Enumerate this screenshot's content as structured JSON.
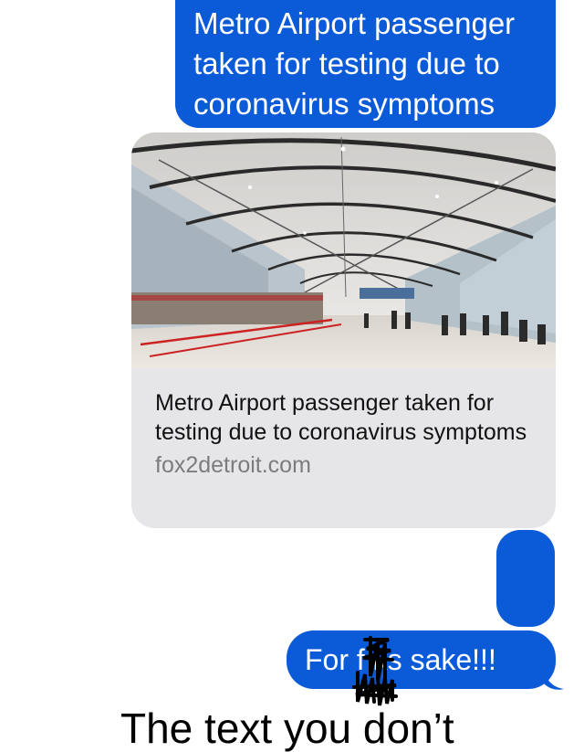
{
  "messages": {
    "first": {
      "text": "Metro Airport passenger taken for testing due to coronavirus symptoms"
    },
    "link_preview": {
      "title": "Metro Airport passenger taken for testing due to coronavirus symptoms",
      "domain": "fox2detroit.com",
      "image": "airport-terminal-photo"
    },
    "second": {
      "text": ""
    },
    "third": {
      "text": "For f  ks sake!!!"
    }
  },
  "footer": {
    "text": "The text you don’t"
  },
  "colors": {
    "bubble_blue": "#0b5bd8",
    "card_gray": "#e6e6e9",
    "domain_gray": "#7c7c80"
  }
}
